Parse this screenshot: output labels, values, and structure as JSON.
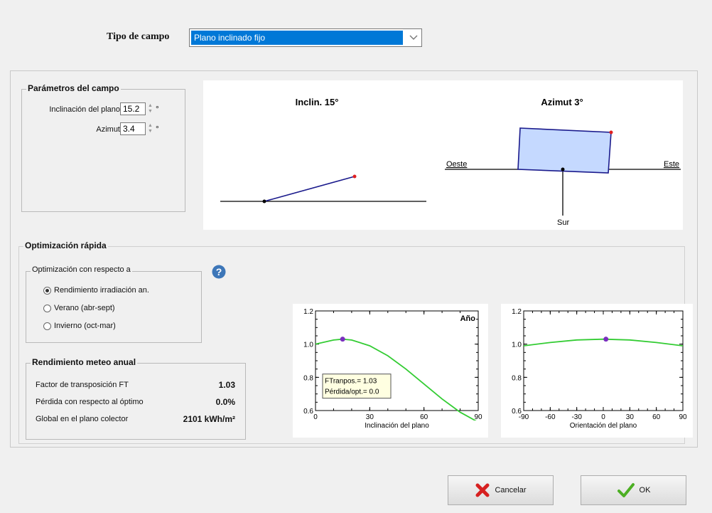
{
  "header": {
    "field_type_label": "Tipo de campo",
    "field_type_value": "Plano inclinado fijo"
  },
  "params": {
    "title": "Parámetros del campo",
    "tilt_label": "Inclinación del plano",
    "tilt_value": "15.2",
    "azimuth_label": "Azimut",
    "azimuth_value": "3.4",
    "degree_unit": "°"
  },
  "diagrams": {
    "tilt_title": "Inclin. 15°",
    "azimuth_title": "Azimut 3°",
    "west": "Oeste",
    "east": "Este",
    "south": "Sur"
  },
  "optimization": {
    "title": "Optimización rápida",
    "respect_title": "Optimización con respecto a",
    "options": [
      {
        "label": "Rendimiento irradiación an.",
        "selected": true
      },
      {
        "label": "Verano (abr-sept)",
        "selected": false
      },
      {
        "label": "Invierno (oct-mar)",
        "selected": false
      }
    ],
    "help_icon": "question-circle-icon"
  },
  "meteo": {
    "title": "Rendimiento meteo anual",
    "rows": [
      {
        "label": "Factor de transposición FT",
        "value": "1.03"
      },
      {
        "label": "Pérdida con respecto al óptimo",
        "value": "0.0%"
      },
      {
        "label": "Global en el plano colector",
        "value": "2101 kWh/m²"
      }
    ]
  },
  "chart_data": [
    {
      "type": "line",
      "title": "Año",
      "xlabel": "Inclinación del plano",
      "ylabel": "",
      "xlim": [
        0,
        90
      ],
      "ylim": [
        0.6,
        1.2
      ],
      "xticks": [
        "0",
        "30",
        "60",
        "90"
      ],
      "yticks": [
        "0.6",
        "0.8",
        "1.0",
        "1.2"
      ],
      "series": [
        {
          "x": [
            0,
            10,
            15,
            20,
            30,
            40,
            50,
            60,
            70,
            80,
            90
          ],
          "y": [
            1.0,
            1.025,
            1.03,
            1.025,
            0.99,
            0.93,
            0.85,
            0.76,
            0.67,
            0.59,
            0.53
          ]
        }
      ],
      "marker": {
        "x": 15,
        "y": 1.03
      },
      "annotation": [
        "FTranpos.= 1.03",
        "Pérdida/opt.= 0.0"
      ]
    },
    {
      "type": "line",
      "title": "",
      "xlabel": "Orientación del plano",
      "ylabel": "",
      "xlim": [
        -90,
        90
      ],
      "ylim": [
        0.6,
        1.2
      ],
      "xticks": [
        "-90",
        "-60",
        "-30",
        "0",
        "30",
        "60",
        "90"
      ],
      "yticks": [
        "0.6",
        "0.8",
        "1.0",
        "1.2"
      ],
      "series": [
        {
          "x": [
            -90,
            -60,
            -30,
            0,
            30,
            60,
            90
          ],
          "y": [
            0.99,
            1.01,
            1.025,
            1.03,
            1.025,
            1.01,
            0.99
          ]
        }
      ],
      "marker": {
        "x": 3,
        "y": 1.03
      }
    }
  ],
  "buttons": {
    "cancel": "Cancelar",
    "ok": "OK"
  },
  "colors": {
    "accent": "#0078d7",
    "curve": "#33cc33",
    "marker": "#7b2fbf",
    "panel_fill": "#c5d9ff"
  }
}
